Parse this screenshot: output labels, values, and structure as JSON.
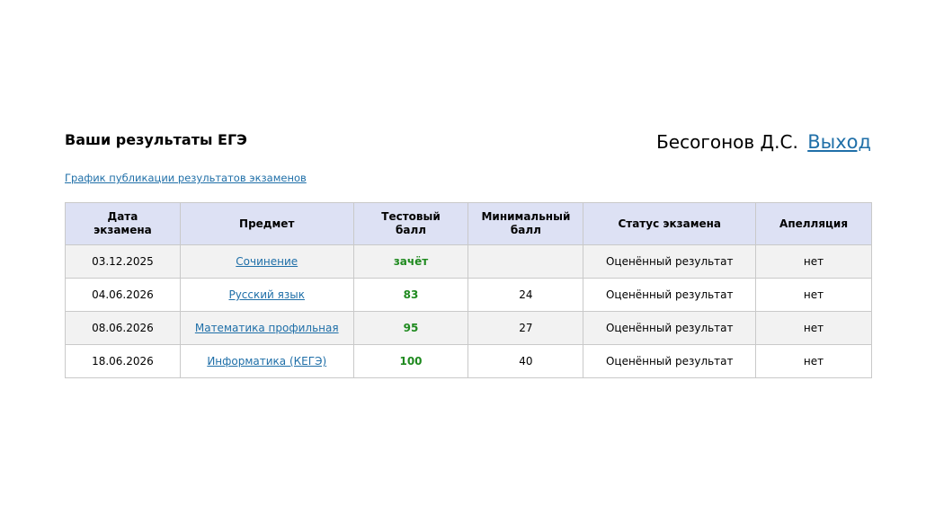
{
  "header": {
    "title": "Ваши результаты ЕГЭ",
    "user_name": "Бесогонов Д.С.",
    "logout_label": "Выход",
    "schedule_link": "График публикации результатов экзаменов"
  },
  "table": {
    "columns": {
      "date": [
        "Дата",
        "экзамена"
      ],
      "subject": [
        "Предмет"
      ],
      "score": [
        "Тестовый",
        "балл"
      ],
      "min_score": [
        "Минимальный",
        "балл"
      ],
      "status": [
        "Статус экзамена"
      ],
      "appeal": [
        "Апелляция"
      ]
    },
    "rows": [
      {
        "date": "03.12.2025",
        "subject": "Сочинение",
        "score": "зачёт",
        "min_score": "",
        "status": "Оценённый результат",
        "appeal": "нет"
      },
      {
        "date": "04.06.2026",
        "subject": "Русский язык",
        "score": "83",
        "min_score": "24",
        "status": "Оценённый результат",
        "appeal": "нет"
      },
      {
        "date": "08.06.2026",
        "subject": "Математика профильная",
        "score": "95",
        "min_score": "27",
        "status": "Оценённый результат",
        "appeal": "нет"
      },
      {
        "date": "18.06.2026",
        "subject": "Информатика (КЕГЭ)",
        "score": "100",
        "min_score": "40",
        "status": "Оценённый результат",
        "appeal": "нет"
      }
    ]
  },
  "colors": {
    "link": "#1f6fa8",
    "score": "#1f8a1f",
    "header_bg": "#dde1f4",
    "row_alt_bg": "#f2f2f2"
  }
}
